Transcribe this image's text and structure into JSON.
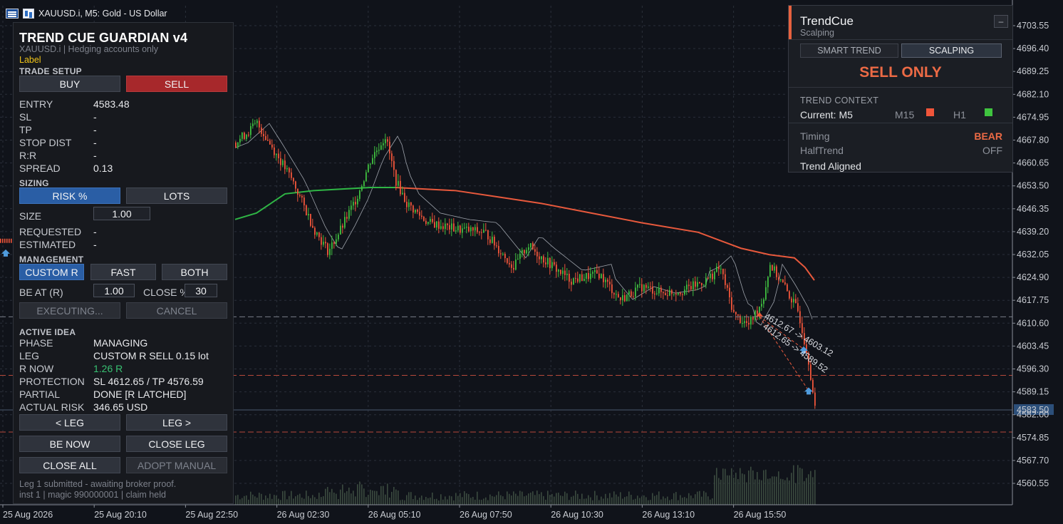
{
  "window": {
    "title": "XAUUSD.i, M5:  Gold - US Dollar"
  },
  "chart": {
    "price_axis_labels": [
      "4703.55",
      "4696.40",
      "4689.25",
      "4682.10",
      "4674.95",
      "4667.80",
      "4660.65",
      "4653.50",
      "4646.35",
      "4639.20",
      "4632.05",
      "4624.90",
      "4617.75",
      "4610.60",
      "4603.45",
      "4596.30",
      "4589.15",
      "4582.00",
      "4574.85",
      "4567.70",
      "4560.55"
    ],
    "time_axis_labels": [
      "25 Aug 2026",
      "25 Aug 20:10",
      "25 Aug 22:50",
      "26 Aug 02:30",
      "26 Aug 05:10",
      "26 Aug 07:50",
      "26 Aug 10:30",
      "26 Aug 13:10",
      "26 Aug 15:50"
    ],
    "current_price_tag": "4583.50",
    "trade_annotations": [
      "4612.67 -> 4603.12",
      "4612.65 -> 4589.52"
    ],
    "colors": {
      "bull": "#3fbf3f",
      "bear": "#f0553a",
      "trend_line_bull": "#2fb545",
      "trend_line_bear": "#e8593c",
      "price_tag": "#2c4f7a"
    }
  },
  "tcg": {
    "title": "TREND CUE GUARDIAN v4",
    "subtitle": "XAUUSD.i  |  Hedging accounts only",
    "label": "Label",
    "sections": {
      "trade_setup": "TRADE SETUP",
      "sizing": "SIZING",
      "management": "MANAGEMENT",
      "active_idea": "ACTIVE IDEA"
    },
    "buttons": {
      "buy": "BUY",
      "sell": "SELL",
      "risk_pct": "RISK %",
      "lots": "LOTS",
      "custom_r": "CUSTOM R",
      "fast": "FAST",
      "both": "BOTH",
      "executing": "EXECUTING...",
      "cancel": "CANCEL",
      "prev_leg": "< LEG",
      "next_leg": "LEG >",
      "be_now": "BE NOW",
      "close_leg": "CLOSE LEG",
      "close_all": "CLOSE ALL",
      "adopt_manual": "ADOPT MANUAL"
    },
    "setup": {
      "entry_label": "ENTRY",
      "entry": "4583.48",
      "sl_label": "SL",
      "sl": "-",
      "tp_label": "TP",
      "tp": "-",
      "stop_dist_label": "STOP DIST",
      "stop_dist": "-",
      "rr_label": "R:R",
      "rr": "-",
      "spread_label": "SPREAD",
      "spread": "0.13"
    },
    "sizing": {
      "size_label": "SIZE",
      "size": "1.00",
      "requested_label": "REQUESTED",
      "requested": "-",
      "estimated_label": "ESTIMATED",
      "estimated": "-"
    },
    "management": {
      "be_at_label": "BE AT (R)",
      "be_at": "1.00",
      "close_pct_label": "CLOSE %",
      "close_pct": "30"
    },
    "active_idea": {
      "phase_label": "PHASE",
      "phase": "MANAGING",
      "leg_label": "LEG",
      "leg": "CUSTOM R  SELL  0.15 lot",
      "r_now_label": "R NOW",
      "r_now": "1.26 R",
      "protection_label": "PROTECTION",
      "protection": "SL 4612.65 / TP 4576.59",
      "partial_label": "PARTIAL",
      "partial": "DONE  [R LATCHED]",
      "actual_risk_label": "ACTUAL RISK",
      "actual_risk": "346.65 USD"
    },
    "footer": {
      "line1": "Leg 1 submitted - awaiting broker proof.",
      "line2": "inst 1 | magic 990000001 | claim held"
    }
  },
  "trendcue": {
    "title": "TrendCue",
    "subtitle": "Scalping",
    "minimize": "–",
    "tabs": [
      "SMART TREND",
      "SCALPING"
    ],
    "active_tab": "SCALPING",
    "signal": "SELL ONLY",
    "context_header": "TREND CONTEXT",
    "current_tf": "Current: M5",
    "tf1": "M15",
    "tf2": "H1",
    "tf1_color": "#f0553a",
    "tf2_color": "#3fc43f",
    "timing_label": "Timing",
    "timing_value": "BEAR",
    "halftrend_label": "HalfTrend",
    "halftrend_value": "OFF",
    "trend_aligned": "Trend Aligned"
  }
}
